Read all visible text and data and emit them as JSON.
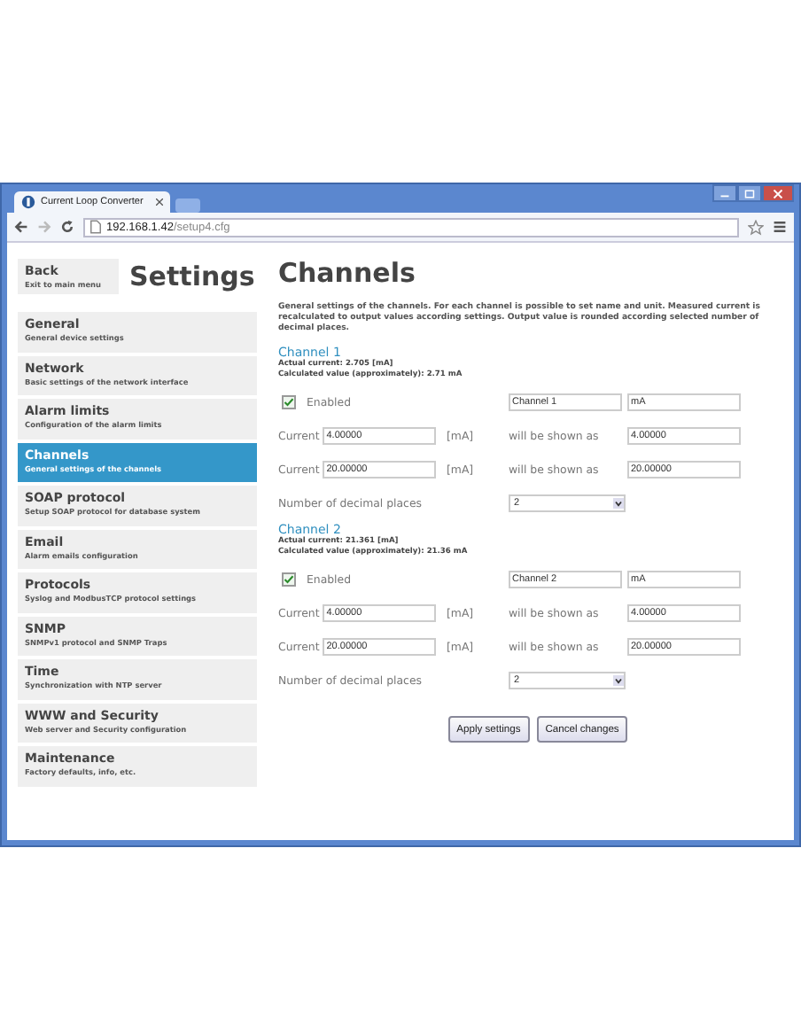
{
  "browser": {
    "tab_title": "Current Loop Converter",
    "url_host": "192.168.1.42",
    "url_path": "/setup4.cfg"
  },
  "back": {
    "label": "Back",
    "sublabel": "Exit to main menu"
  },
  "settings_title": "Settings",
  "menu": [
    {
      "title": "General",
      "subtitle": "General device settings",
      "selected": false
    },
    {
      "title": "Network",
      "subtitle": "Basic settings of the network interface",
      "selected": false
    },
    {
      "title": "Alarm limits",
      "subtitle": "Configuration of the alarm limits",
      "selected": false
    },
    {
      "title": "Channels",
      "subtitle": "General settings of the channels",
      "selected": true
    },
    {
      "title": "SOAP protocol",
      "subtitle": "Setup SOAP protocol for database system",
      "selected": false
    },
    {
      "title": "Email",
      "subtitle": "Alarm emails configuration",
      "selected": false
    },
    {
      "title": "Protocols",
      "subtitle": "Syslog and ModbusTCP protocol settings",
      "selected": false
    },
    {
      "title": "SNMP",
      "subtitle": "SNMPv1 protocol and SNMP Traps",
      "selected": false
    },
    {
      "title": "Time",
      "subtitle": "Synchronization with NTP server",
      "selected": false
    },
    {
      "title": "WWW and Security",
      "subtitle": "Web server and Security configuration",
      "selected": false
    },
    {
      "title": "Maintenance",
      "subtitle": "Factory defaults, info, etc.",
      "selected": false
    }
  ],
  "page_title": "Channels",
  "description": "General settings of the channels. For each channel is possible to set name and unit. Measured current is recalculated to output values according settings. Output value is rounded according selected number of decimal places.",
  "channels": [
    {
      "title": "Channel 1",
      "actual": "Actual current: 2.705 [mA]",
      "calculated": "Calculated value (approximately): 2.71 mA",
      "enabled": true,
      "enabled_label": "Enabled",
      "name": "Channel 1",
      "unit": "mA",
      "rows": [
        {
          "label": "Current",
          "value": "4.00000",
          "unit": "[mA]",
          "shown_label": "will be shown as",
          "shown_value": "4.00000"
        },
        {
          "label": "Current",
          "value": "20.00000",
          "unit": "[mA]",
          "shown_label": "will be shown as",
          "shown_value": "20.00000"
        }
      ],
      "decimals_label": "Number of decimal places",
      "decimals": "2"
    },
    {
      "title": "Channel 2",
      "actual": "Actual current: 21.361 [mA]",
      "calculated": "Calculated value (approximately): 21.36 mA",
      "enabled": true,
      "enabled_label": "Enabled",
      "name": "Channel 2",
      "unit": "mA",
      "rows": [
        {
          "label": "Current",
          "value": "4.00000",
          "unit": "[mA]",
          "shown_label": "will be shown as",
          "shown_value": "4.00000"
        },
        {
          "label": "Current",
          "value": "20.00000",
          "unit": "[mA]",
          "shown_label": "will be shown as",
          "shown_value": "20.00000"
        }
      ],
      "decimals_label": "Number of decimal places",
      "decimals": "2"
    }
  ],
  "buttons": [
    "Apply settings",
    "Cancel changes"
  ]
}
